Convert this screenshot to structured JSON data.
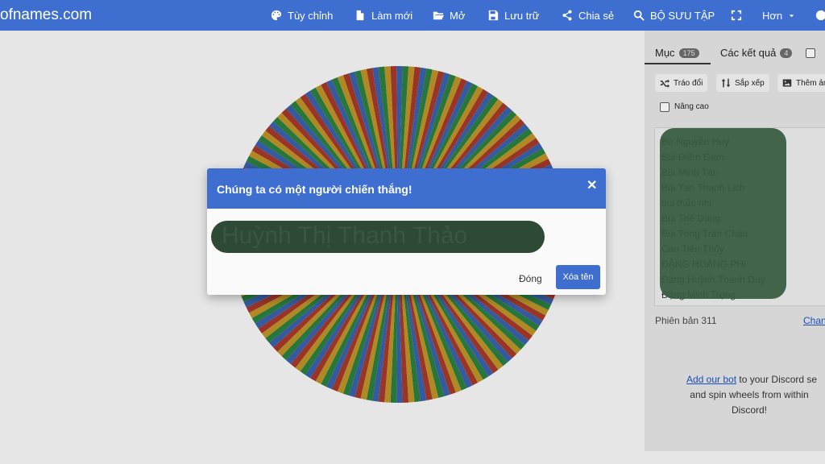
{
  "header": {
    "brand": "ofnames.com",
    "nav": [
      {
        "label": "Tùy chỉnh",
        "icon": "palette-icon"
      },
      {
        "label": "Làm mới",
        "icon": "file-icon"
      },
      {
        "label": "Mở",
        "icon": "folder-open-icon"
      },
      {
        "label": "Lưu trữ",
        "icon": "save-icon"
      },
      {
        "label": "Chia sẻ",
        "icon": "share-icon"
      },
      {
        "label": "BỘ SƯU TẬP",
        "icon": "search-icon"
      },
      {
        "label": "",
        "icon": "fullscreen-icon"
      },
      {
        "label": "Hơn",
        "icon": "chevron-down-icon"
      },
      {
        "label": "",
        "icon": "globe-icon"
      }
    ]
  },
  "wheel": {
    "colors": [
      "#2a9a45",
      "#e8b020",
      "#d0402d",
      "#3f74d6"
    ],
    "segment_count": 175
  },
  "panel": {
    "tab_entries": "Mục",
    "tab_entries_count": "175",
    "tab_results": "Các kết quả",
    "tab_results_count": "4",
    "shuffle_label": "Tráo đổi",
    "sort_label": "Sắp xếp",
    "add_image_label": "Thêm ản",
    "advanced_label": "Nâng cao",
    "entries": [
      "Bồ Nguyễn Huy",
      "Bùi Điềm Đạm",
      "Bùi Minh Tân",
      "Bùi Tạn Thanh Lịch",
      "bùi thảo nhi",
      "Bùi Thế Dũng",
      "Bùi Tống Trân Châu",
      "Cao Tiến Thủy",
      "ĐẶNG HOÀNG PHI",
      "Đặng Huỳnh Thanh Duy",
      "Đặng Minh Trọng"
    ],
    "version": "Phiên bản 311",
    "changelog": "Chan",
    "discord_link": "Add our bot",
    "discord_text_1": " to your Discord se",
    "discord_text_2": "and spin wheels from within",
    "discord_text_3": "Discord!"
  },
  "modal": {
    "title": "Chúng ta có một người chiến thắng!",
    "close_icon": "close-icon",
    "winner": "Huỳnh Thị Thanh Thảo",
    "close_label": "Đóng",
    "remove_label": "Xóa tên"
  }
}
